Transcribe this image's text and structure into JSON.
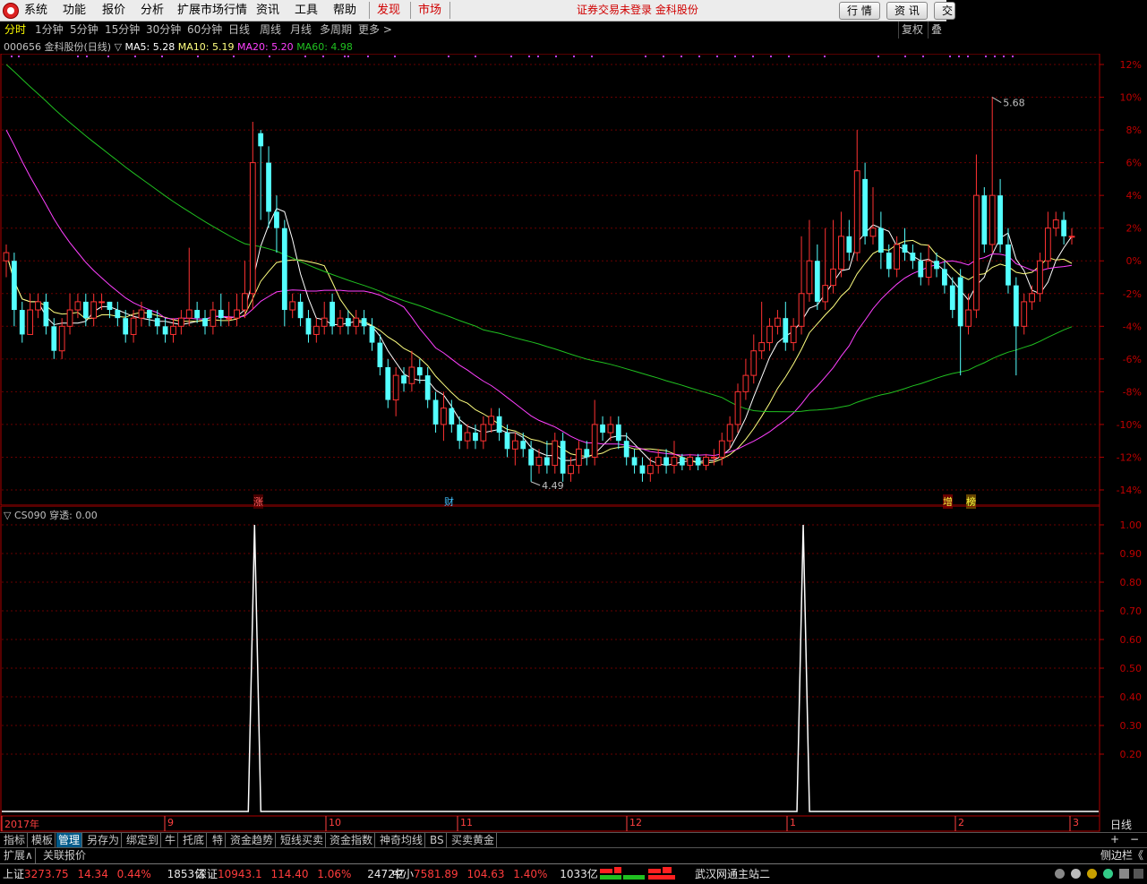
{
  "menu": {
    "items": [
      "系统",
      "功能",
      "报价",
      "分析",
      "扩展市场行情",
      "资讯",
      "工具",
      "帮助"
    ],
    "discover": "发现",
    "market": "市场",
    "notice": "证券交易未登录  金科股份",
    "buttons": [
      "行 情",
      "资 讯",
      "交"
    ]
  },
  "periods": [
    "分时",
    "1分钟",
    "5分钟",
    "15分钟",
    "30分钟",
    "60分钟",
    "日线",
    "周线",
    "月线",
    "多周期",
    "更多 >"
  ],
  "right_buttons": [
    "复权",
    "叠加"
  ],
  "main_title": {
    "stock": "000656 金科股份(日线) ▽",
    "ma5": "MA5: 5.28",
    "ma10": "MA10: 5.19",
    "ma20": "MA20: 5.20",
    "ma60": "MA60: 4.98",
    "colors": {
      "ma5": "#ffffff",
      "ma10": "#ffff80",
      "ma20": "#ff40ff",
      "ma60": "#20c020"
    }
  },
  "main_yaxis": [
    "12%",
    "10%",
    "8%",
    "6%",
    "4%",
    "2%",
    "0%",
    "-2%",
    "-4%",
    "-6%",
    "-8%",
    "-10%",
    "-12%",
    "-14%"
  ],
  "annotations": {
    "high": "5.68",
    "low": "4.49"
  },
  "event_markers": [
    "涨",
    "财",
    "增",
    "榜"
  ],
  "indicator": {
    "title": "▽ CS090  穿透: 0.00",
    "yaxis": [
      "1.00",
      "0.90",
      "0.80",
      "0.70",
      "0.60",
      "0.50",
      "0.40",
      "0.30",
      "0.20"
    ]
  },
  "xaxis": {
    "labels": [
      "2017年",
      "9",
      "10",
      "11",
      "12",
      "1",
      "2",
      "3"
    ],
    "period_label": "日线"
  },
  "chart_data": [
    {
      "type": "candlestick",
      "title": "000656 金科股份(日线)",
      "y_unit": "%",
      "ylim": [
        -14.5,
        12.5
      ],
      "highlights": {
        "max": 5.68,
        "min": 4.49
      },
      "candles_pct": [
        [
          0,
          0.5,
          -1.0,
          1.0
        ],
        [
          0,
          -3.0,
          -4.0,
          0.5
        ],
        [
          -3.0,
          -4.5,
          -5.0,
          -2.5
        ],
        [
          -4.5,
          -3.0,
          -3.5,
          -2.0
        ],
        [
          -3.0,
          -2.5,
          -3.5,
          -2.0
        ],
        [
          -2.5,
          -4.0,
          -4.5,
          -2.0
        ],
        [
          -4.0,
          -5.5,
          -6.0,
          -3.5
        ],
        [
          -5.5,
          -4.0,
          -6.0,
          -3.5
        ],
        [
          -4.0,
          -3.0,
          -4.5,
          -2.0
        ],
        [
          -3.0,
          -2.5,
          -3.5,
          -2.0
        ],
        [
          -2.5,
          -3.5,
          -4.0,
          -2.0
        ],
        [
          -3.5,
          -2.5,
          -4.0,
          -2.0
        ],
        [
          -2.5,
          -2.5,
          -3.0,
          -2.0
        ],
        [
          -2.5,
          -3.0,
          -3.5,
          -2.5
        ],
        [
          -3.0,
          -3.5,
          -4.0,
          -2.5
        ],
        [
          -3.5,
          -4.5,
          -5.0,
          -3.0
        ],
        [
          -4.5,
          -3.5,
          -5.0,
          -3.0
        ],
        [
          -3.5,
          -3.0,
          -4.0,
          -2.5
        ],
        [
          -3.0,
          -3.5,
          -4.0,
          -3.0
        ],
        [
          -3.5,
          -4.0,
          -4.5,
          -3.0
        ],
        [
          -4.0,
          -4.5,
          -5.0,
          -3.5
        ],
        [
          -4.5,
          -4.0,
          -5.0,
          -3.5
        ],
        [
          -4.0,
          -3.5,
          -4.5,
          -3.0
        ],
        [
          -3.5,
          -3.0,
          -4.0,
          0.8
        ],
        [
          -3.0,
          -3.5,
          -3.8,
          -2.5
        ],
        [
          -3.5,
          -4.0,
          -4.5,
          -3.0
        ],
        [
          -4.0,
          -3.0,
          -4.5,
          -2.5
        ],
        [
          -3.0,
          -3.5,
          -4.0,
          -2.0
        ],
        [
          -3.5,
          -3.5,
          -4.0,
          -2.5
        ],
        [
          -3.5,
          -3.0,
          -4.0,
          -2.0
        ],
        [
          -3.0,
          -2.0,
          -3.5,
          0.0
        ],
        [
          -2.0,
          6.0,
          -3.0,
          8.5
        ],
        [
          7.8,
          7.0,
          2.5,
          8.0
        ],
        [
          6.0,
          3.0,
          2.0,
          7.0
        ],
        [
          3.0,
          2.0,
          0.5,
          4.0
        ],
        [
          2.0,
          -3.0,
          -4.0,
          2.5
        ],
        [
          -3.0,
          -2.5,
          -3.5,
          -2.0
        ],
        [
          -2.5,
          -3.5,
          -4.0,
          -2.0
        ],
        [
          -3.5,
          -4.5,
          -5.0,
          -3.0
        ],
        [
          -4.5,
          -4.0,
          -5.0,
          -3.5
        ],
        [
          -4.0,
          -3.5,
          -4.5,
          -2.5
        ],
        [
          -2.5,
          -4.0,
          -4.5,
          -2.0
        ],
        [
          -4.0,
          -3.5,
          -4.5,
          -3.0
        ],
        [
          -3.5,
          -4.0,
          -4.5,
          -3.0
        ],
        [
          -4.0,
          -3.5,
          -4.5,
          -3.0
        ],
        [
          -3.5,
          -4.0,
          -4.5,
          -3.0
        ],
        [
          -4.0,
          -5.0,
          -5.5,
          -3.5
        ],
        [
          -5.0,
          -6.5,
          -7.0,
          -4.5
        ],
        [
          -6.5,
          -8.5,
          -9.0,
          -6.0
        ],
        [
          -8.5,
          -7.0,
          -9.5,
          -6.5
        ],
        [
          -7.0,
          -7.5,
          -8.0,
          -6.5
        ],
        [
          -7.5,
          -6.5,
          -8.0,
          -5.5
        ],
        [
          -6.5,
          -7.0,
          -7.5,
          -6.0
        ],
        [
          -7.0,
          -8.5,
          -9.0,
          -6.5
        ],
        [
          -8.5,
          -10.0,
          -10.5,
          -8.0
        ],
        [
          -10.0,
          -9.0,
          -11.0,
          -8.0
        ],
        [
          -9.0,
          -10.0,
          -10.5,
          -8.5
        ],
        [
          -10.0,
          -11.0,
          -11.5,
          -9.5
        ],
        [
          -11.0,
          -10.5,
          -11.5,
          -10.0
        ],
        [
          -10.5,
          -11.0,
          -11.5,
          -10.0
        ],
        [
          -11.0,
          -10.0,
          -11.5,
          -9.5
        ],
        [
          -10.0,
          -9.5,
          -10.5,
          -9.0
        ],
        [
          -9.5,
          -10.5,
          -11.0,
          -9.0
        ],
        [
          -10.5,
          -11.5,
          -12.0,
          -10.0
        ],
        [
          -11.5,
          -11.0,
          -12.5,
          -10.5
        ],
        [
          -11.0,
          -11.5,
          -12.0,
          -10.5
        ],
        [
          -11.5,
          -12.5,
          -13.5,
          -11.0
        ],
        [
          -12.5,
          -12.0,
          -13.0,
          -11.5
        ],
        [
          -12.0,
          -12.5,
          -13.0,
          -11.0
        ],
        [
          -12.5,
          -11.0,
          -13.0,
          -10.5
        ],
        [
          -11.0,
          -13.0,
          -13.5,
          -10.5
        ],
        [
          -13.0,
          -12.5,
          -13.5,
          -12.0
        ],
        [
          -12.5,
          -11.5,
          -13.0,
          -11.0
        ],
        [
          -11.5,
          -12.0,
          -12.5,
          -11.0
        ],
        [
          -12.0,
          -10.0,
          -12.5,
          -8.5
        ],
        [
          -10.0,
          -10.5,
          -11.0,
          -9.5
        ],
        [
          -10.5,
          -10.0,
          -11.0,
          -9.5
        ],
        [
          -10.0,
          -11.0,
          -11.5,
          -9.5
        ],
        [
          -11.0,
          -12.0,
          -12.5,
          -10.5
        ],
        [
          -12.0,
          -12.5,
          -13.0,
          -11.5
        ],
        [
          -12.5,
          -13.0,
          -13.5,
          -12.0
        ],
        [
          -13.0,
          -12.5,
          -13.5,
          -12.0
        ],
        [
          -12.5,
          -12.0,
          -13.0,
          -11.5
        ],
        [
          -12.0,
          -12.5,
          -13.0,
          -11.5
        ],
        [
          -12.5,
          -12.0,
          -13.0,
          -11.0
        ],
        [
          -12.0,
          -12.5,
          -12.8,
          -11.8
        ],
        [
          -12.5,
          -12.0,
          -12.8,
          -11.8
        ],
        [
          -12.0,
          -12.5,
          -12.8,
          -11.8
        ],
        [
          -12.5,
          -12.0,
          -12.8,
          -11.8
        ],
        [
          -12.0,
          -12.0,
          -12.5,
          -11.5
        ],
        [
          -12.0,
          -11.0,
          -12.5,
          -10.5
        ],
        [
          -11.0,
          -10.0,
          -11.5,
          -9.5
        ],
        [
          -10.0,
          -8.0,
          -10.5,
          -7.5
        ],
        [
          -8.0,
          -7.0,
          -8.5,
          -6.0
        ],
        [
          -7.0,
          -5.5,
          -7.5,
          -4.5
        ],
        [
          -5.5,
          -5.0,
          -6.0,
          -2.5
        ],
        [
          -5.0,
          -4.0,
          -5.5,
          -3.5
        ],
        [
          -4.0,
          -3.5,
          -4.5,
          -3.0
        ],
        [
          -3.5,
          -5.0,
          -5.5,
          -2.5
        ],
        [
          -5.0,
          -4.0,
          -5.5,
          -3.5
        ],
        [
          -4.0,
          -2.0,
          -4.5,
          1.5
        ],
        [
          -2.0,
          0.0,
          -2.5,
          2.5
        ],
        [
          0.0,
          -2.5,
          -3.0,
          1.0
        ],
        [
          -2.5,
          -1.5,
          -3.0,
          2.0
        ],
        [
          -1.5,
          -0.5,
          -2.0,
          2.5
        ],
        [
          -0.5,
          1.5,
          -1.0,
          3.0
        ],
        [
          1.5,
          0.5,
          0.0,
          2.5
        ],
        [
          0.5,
          5.5,
          0.0,
          8.0
        ],
        [
          5.0,
          1.5,
          1.0,
          6.0
        ],
        [
          1.5,
          2.0,
          1.0,
          4.5
        ],
        [
          2.0,
          0.5,
          -0.5,
          3.0
        ],
        [
          0.5,
          -0.5,
          -1.0,
          1.0
        ],
        [
          -0.5,
          1.0,
          -1.0,
          1.5
        ],
        [
          1.0,
          0.5,
          0.0,
          2.0
        ],
        [
          0.5,
          0.0,
          -0.5,
          1.0
        ],
        [
          0.0,
          -1.0,
          -1.5,
          0.5
        ],
        [
          -1.0,
          0.0,
          -1.5,
          1.0
        ],
        [
          0.0,
          -0.5,
          -1.0,
          0.5
        ],
        [
          -0.5,
          -1.5,
          -2.0,
          0.0
        ],
        [
          -1.5,
          -3.0,
          -3.5,
          -1.0
        ],
        [
          -1.0,
          -4.0,
          -7.0,
          -0.5
        ],
        [
          -4.0,
          -3.0,
          -4.5,
          -2.0
        ],
        [
          -3.0,
          4.0,
          -3.5,
          6.5
        ],
        [
          4.0,
          1.0,
          0.5,
          4.5
        ],
        [
          1.0,
          4.0,
          0.5,
          10.0
        ],
        [
          4.0,
          1.0,
          0.5,
          5.0
        ],
        [
          1.0,
          -1.5,
          -2.0,
          2.0
        ],
        [
          -1.5,
          -4.0,
          -7.0,
          -1.0
        ],
        [
          -4.0,
          -2.5,
          -4.5,
          -2.0
        ],
        [
          -2.5,
          -2.0,
          -3.0,
          -1.5
        ],
        [
          -2.0,
          0.0,
          -2.5,
          0.5
        ],
        [
          0.0,
          2.0,
          -0.5,
          3.0
        ],
        [
          2.0,
          2.5,
          1.5,
          3.0
        ],
        [
          2.5,
          1.5,
          1.0,
          3.0
        ],
        [
          1.5,
          1.5,
          1.0,
          2.0
        ]
      ]
    },
    {
      "type": "line",
      "title": "CS090 穿透",
      "ylim": [
        0,
        1.05
      ],
      "spikes_at_candle_index": [
        31,
        100
      ],
      "value": 0.0
    }
  ]
}
